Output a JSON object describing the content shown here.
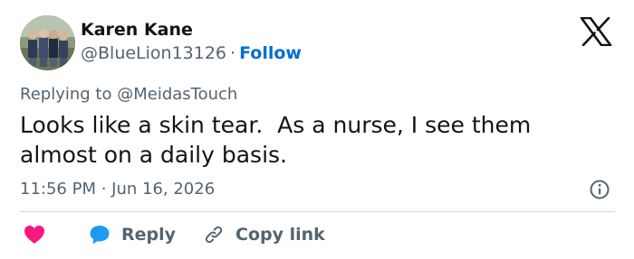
{
  "author": {
    "name": "Karen Kane",
    "handle": "@BlueLion13126",
    "separator": "·",
    "follow_label": "Follow",
    "avatar": "group-photo-avatar"
  },
  "platform": {
    "logo": "x-logo-icon"
  },
  "reply_context": {
    "prefix": "Replying to",
    "mention": "@MeidasTouch"
  },
  "tweet": {
    "text": "Looks like a skin tear.  As a nurse, I see them\nalmost on a daily basis.",
    "timestamp": "11:56 PM · Jun 16, 2026"
  },
  "actions": {
    "like_icon": "heart-icon",
    "reply_icon": "speech-bubble-icon",
    "reply_label": "Reply",
    "copy_icon": "link-icon",
    "copy_label": "Copy link"
  },
  "colors": {
    "text_primary": "#0f1419",
    "text_secondary": "#536471",
    "follow_blue": "#006fd6",
    "like_red": "#f91880",
    "reply_blue": "#1d9bf0",
    "divider": "#cfd9de"
  }
}
